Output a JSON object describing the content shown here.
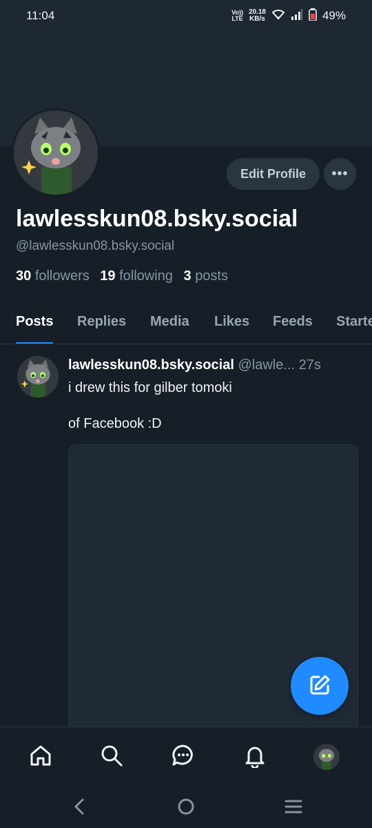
{
  "status_bar": {
    "time": "11:04",
    "network_label_top": "Vo))",
    "network_label_bottom": "LTE",
    "speed_value": "20.18",
    "speed_unit": "KB/s",
    "battery": "49%"
  },
  "profile": {
    "display_name": "lawlesskun08.bsky.social",
    "handle": "@lawlesskun08.bsky.social",
    "followers_count": "30",
    "followers_label": "followers",
    "following_count": "19",
    "following_label": "following",
    "posts_count": "3",
    "posts_label": "posts",
    "edit_button": "Edit Profile",
    "more_button": "•••"
  },
  "tabs": [
    {
      "label": "Posts",
      "active": true
    },
    {
      "label": "Replies"
    },
    {
      "label": "Media"
    },
    {
      "label": "Likes"
    },
    {
      "label": "Feeds"
    },
    {
      "label": "Starter"
    }
  ],
  "post": {
    "author": "lawlesskun08.bsky.social",
    "handle": "@lawle...",
    "time": "27s",
    "text_line1": "i drew this for gilber tomoki",
    "text_line2": "of Facebook :D"
  },
  "bottom_nav": [
    "home-icon",
    "search-icon",
    "chat-icon",
    "bell-icon",
    "profile-avatar"
  ],
  "system_nav": [
    "back-icon",
    "home-circle-icon",
    "recents-icon"
  ],
  "colors": {
    "background": "#161e27",
    "banner": "#1e2833",
    "accent": "#208bfe",
    "muted_text": "#8795a5",
    "button_bg": "#2a3542"
  }
}
